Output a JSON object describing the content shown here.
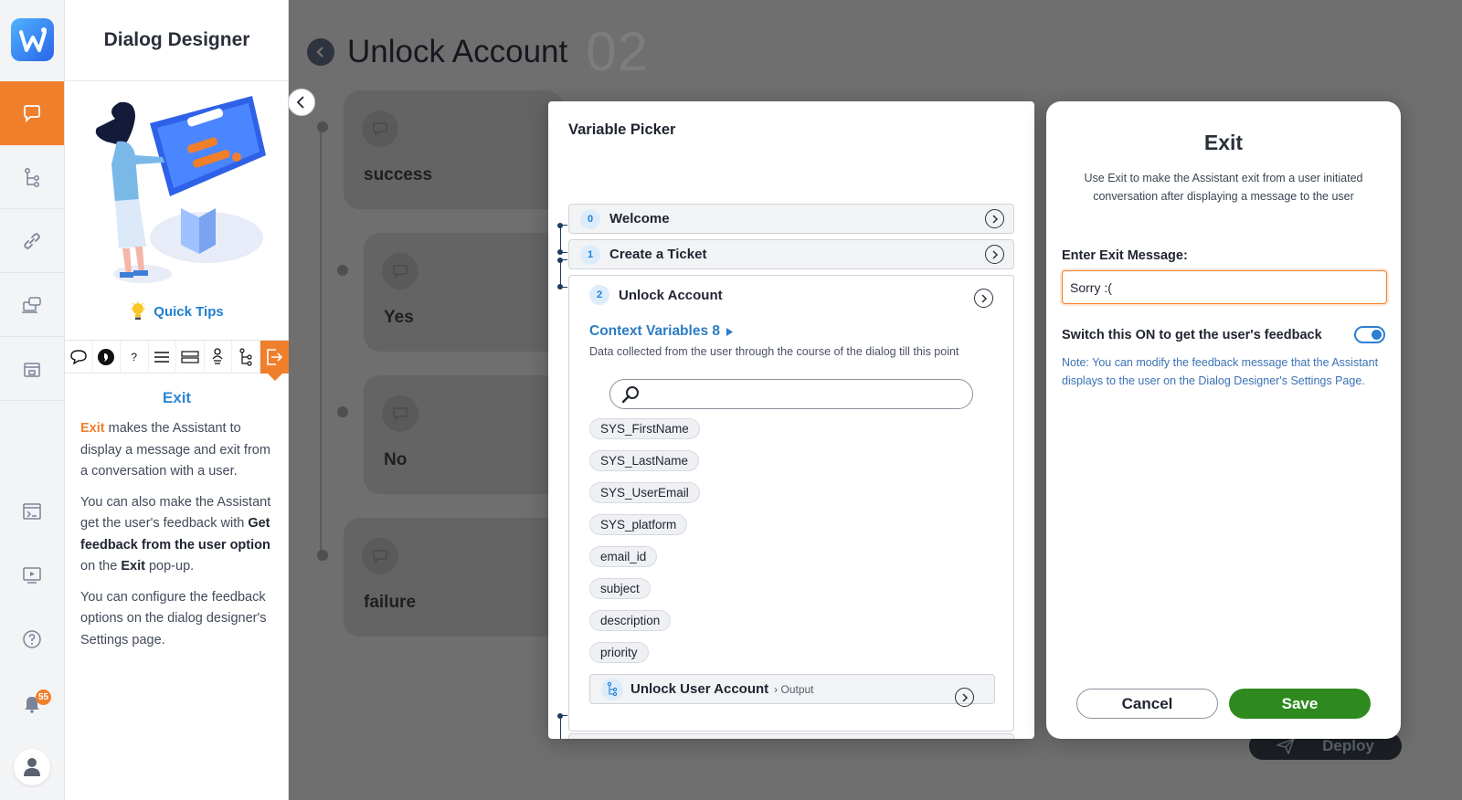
{
  "sidebar": {
    "app_title": "Dialog Designer",
    "notification_count": "55",
    "quick_tips_label": "Quick Tips",
    "toolbar_icons": [
      "speech-bubble-icon",
      "send-message-icon",
      "question-icon",
      "list-icon",
      "multi-choice-icon",
      "person-icon",
      "flow-icon",
      "exit-icon"
    ],
    "help": {
      "heading": "Exit",
      "p1_keyword": "Exit",
      "p1_rest": "makes the Assistant to display a message and exit from a conversation with a user.",
      "p2_a": "You can also make the Assistant get the user's feedback with",
      "p2_b": "Get feedback from the user option",
      "p2_c": "on the",
      "p2_d": "Exit",
      "p2_e": "pop-up.",
      "p3": "You can configure the feedback options on the dialog designer's Settings page."
    }
  },
  "canvas": {
    "title": "Unlock Account",
    "number": "02",
    "cards": [
      "success",
      "Yes",
      "No",
      "failure"
    ],
    "deploy_label": "Deploy"
  },
  "picker": {
    "title": "Variable Picker",
    "steps": [
      {
        "num": "0",
        "name": "Welcome"
      },
      {
        "num": "1",
        "name": "Create a Ticket"
      },
      {
        "num": "2",
        "name": "Unlock Account"
      }
    ],
    "context_title": "Context Variables 8",
    "context_desc": "Data collected from the user through the course of the dialog till this point",
    "search_placeholder": "",
    "variables": [
      "SYS_FirstName",
      "SYS_LastName",
      "SYS_UserEmail",
      "SYS_platform",
      "email_id",
      "subject",
      "description",
      "priority"
    ],
    "sub_step": {
      "name": "Unlock User Account",
      "tag": "› Output"
    }
  },
  "exit_dialog": {
    "title": "Exit",
    "description": "Use Exit to make the Assistant exit from a user initiated conversation after displaying a message to the user",
    "message_label": "Enter Exit Message:",
    "message_value": "Sorry :(",
    "feedback_label": "Switch this ON to get the user's feedback",
    "feedback_on": true,
    "feedback_note": "Note: You can modify the feedback message that the Assistant displays to the user on the Dialog Designer's Settings Page.",
    "cancel_label": "Cancel",
    "save_label": "Save"
  },
  "colors": {
    "accent_orange": "#f07f2c",
    "link_blue": "#2f86d6",
    "save_green": "#2e8a1e"
  }
}
